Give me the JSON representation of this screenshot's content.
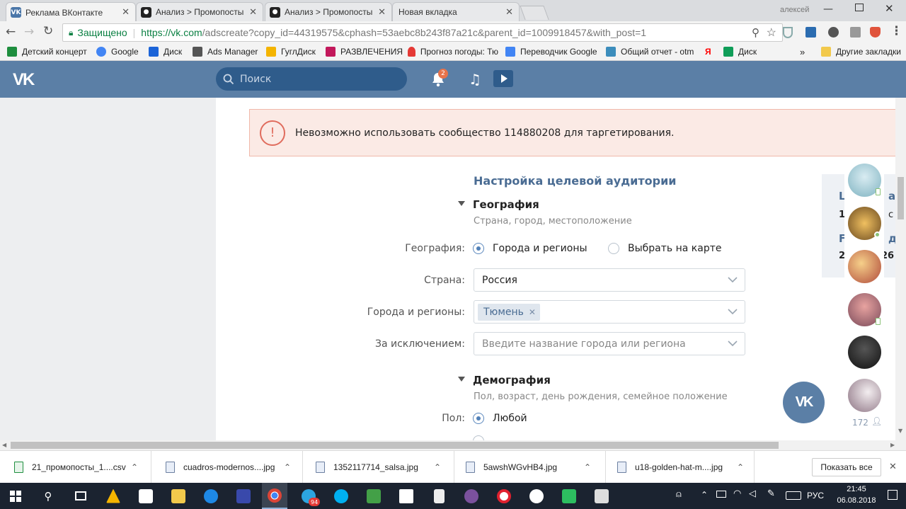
{
  "browser": {
    "tabs": [
      {
        "label": "Реклама ВКонтакте",
        "active": true
      },
      {
        "label": "Анализ > Промопосты -",
        "active": false
      },
      {
        "label": "Анализ > Промопосты -",
        "active": false
      },
      {
        "label": "Новая вкладка",
        "active": false
      }
    ],
    "user_label": "алексей",
    "secure_label": "Защищено",
    "url_host": "https://vk.com",
    "url_path": "/adscreate?copy_id=44319575&cphash=53aebc8b243f87a21c&parent_id=1009918457&with_post=1",
    "bookmarks": [
      {
        "label": "Детский концерт",
        "color": "#1e8e3e"
      },
      {
        "label": "Google",
        "color": "#4285f4"
      },
      {
        "label": "Диск",
        "color": "#1c64d8"
      },
      {
        "label": "Ads Manager",
        "color": "#555555"
      },
      {
        "label": "ГуглДиск",
        "color": "#f4b400"
      },
      {
        "label": "РАЗВЛЕЧЕНИЯ",
        "color": "#c2185b"
      },
      {
        "label": "Прогноз погоды: Тю",
        "color": "#e53935"
      },
      {
        "label": "Переводчик Google",
        "color": "#4285f4"
      },
      {
        "label": "Общий отчет - otm",
        "color": "#3c8dbc"
      },
      {
        "label": "Я",
        "color": "#ff0000"
      },
      {
        "label": "Диск",
        "color": "#0f9d58"
      }
    ],
    "more_bookmarks": "»",
    "other_bookmarks": "Другие закладки"
  },
  "vk": {
    "search_placeholder": "Поиск",
    "notification_count": "2"
  },
  "error": {
    "icon": "!",
    "message": "Невозможно использовать сообщество 114880208 для таргетирования."
  },
  "audience": {
    "title": "Настройка целевой аудитории",
    "geo_title": "География",
    "geo_sub": "Страна, город, местоположение",
    "geo_label": "География:",
    "geo_option_1": "Города и регионы",
    "geo_option_2": "Выбрать на карте",
    "country_label": "Страна:",
    "country_value": "Россия",
    "cities_label": "Города и регионы:",
    "city_token": "Тюмень",
    "token_remove": "✕",
    "exclude_label": "За исключением:",
    "exclude_placeholder": "Введите название города или региона",
    "demo_title": "Демография",
    "demo_sub": "Пол, возраст, день рождения, семейное положение",
    "gender_label": "Пол:",
    "gender_option_1": "Любой"
  },
  "friends": {
    "count": "172"
  },
  "right_stub": {
    "line1": "L",
    "line1_end": "a",
    "line2": "1",
    "line2_end": "c",
    "line3": "F",
    "line3_end": "д",
    "line4": "2",
    "line4_end": "26"
  },
  "downloads": {
    "items": [
      "21_промопосты_1....csv",
      "cuadros-modernos....jpg",
      "1352117714_salsa.jpg",
      "5awshWGvHB4.jpg",
      "u18-golden-hat-m....jpg"
    ],
    "show_all": "Показать все",
    "close": "✕"
  },
  "taskbar": {
    "language": "РУС",
    "time": "21:45",
    "date": "06.08.2018",
    "telegram_badge": "94"
  }
}
